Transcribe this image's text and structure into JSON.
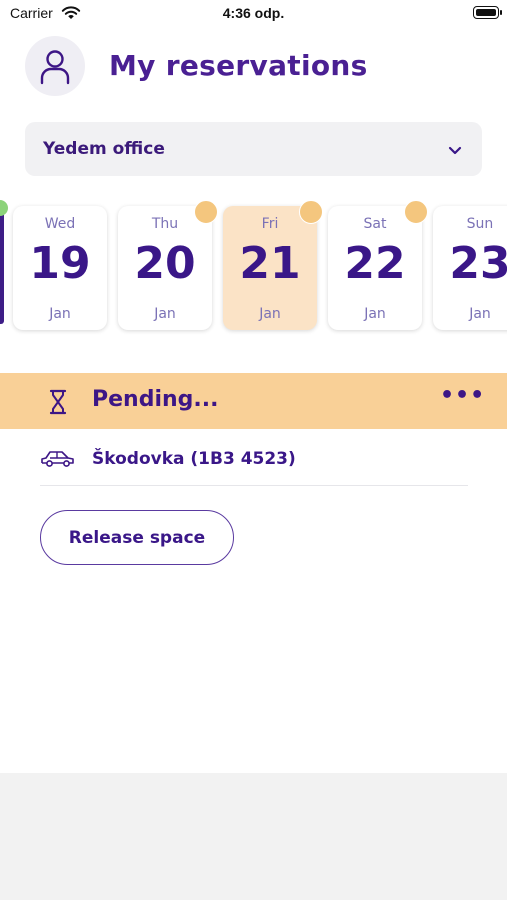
{
  "status_bar": {
    "carrier": "Carrier",
    "time": "4:36 odp."
  },
  "header": {
    "title": "My reservations"
  },
  "office_select": {
    "value": "Yedem office"
  },
  "days": [
    {
      "weekday": "Wed",
      "day": "19",
      "month": "Jan",
      "selected": false,
      "dot": false
    },
    {
      "weekday": "Thu",
      "day": "20",
      "month": "Jan",
      "selected": false,
      "dot": true
    },
    {
      "weekday": "Fri",
      "day": "21",
      "month": "Jan",
      "selected": true,
      "dot": true
    },
    {
      "weekday": "Sat",
      "day": "22",
      "month": "Jan",
      "selected": false,
      "dot": true
    },
    {
      "weekday": "Sun",
      "day": "23",
      "month": "Jan",
      "selected": false,
      "dot": false
    }
  ],
  "reservation": {
    "status": "Pending...",
    "more_label": "•••",
    "vehicle": "Škodovka (1B3 4523)",
    "release_label": "Release space"
  },
  "colors": {
    "accent": "#4a2093",
    "pending_bg": "#f9d097",
    "selected_day_bg": "#fbe3c6",
    "dot": "#f4c67e",
    "green_dot": "#8cd37a"
  },
  "icons": {
    "avatar": "user-icon",
    "select": "chevron-down-icon",
    "status": "hourglass-icon",
    "more": "more-icon",
    "vehicle": "car-icon"
  }
}
